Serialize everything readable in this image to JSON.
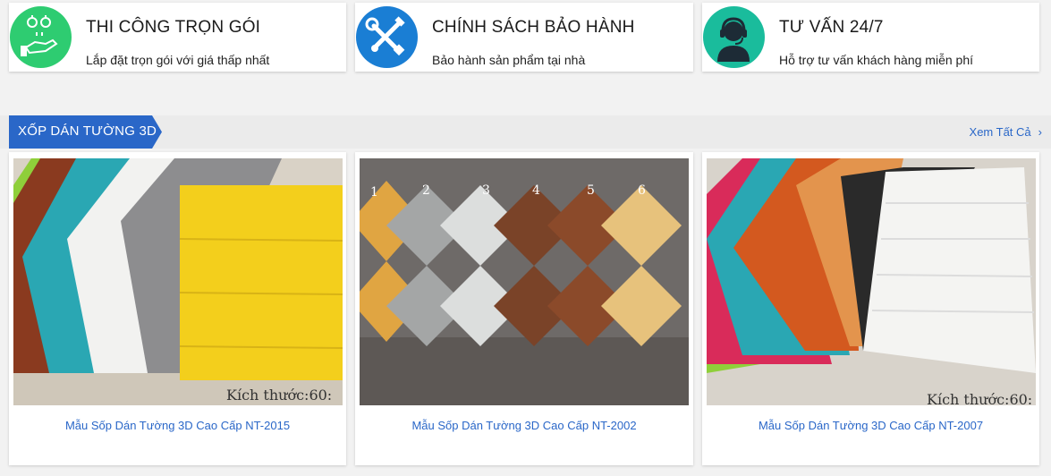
{
  "features": [
    {
      "title": "THI CÔNG TRỌN GÓI",
      "desc": "Lắp đặt trọn gói với giá thấp nhất",
      "icon": "money-hand-icon",
      "color": "#2ecc71"
    },
    {
      "title": "CHÍNH SÁCH BẢO HÀNH",
      "desc": "Bảo hành sản phẩm tại nhà",
      "icon": "tools-icon",
      "color": "#1a7ed4"
    },
    {
      "title": "TƯ VẤN 24/7",
      "desc": "Hỗ trợ tư vấn khách hàng miễn phí",
      "icon": "support-agent-icon",
      "color": "#1abc9c"
    }
  ],
  "section": {
    "title": "XỐP DÁN TƯỜNG 3D",
    "see_all": "Xem Tất Cả",
    "accent": "#2a67c8"
  },
  "products": [
    {
      "name": "Mẫu Sốp Dán Tường 3D Cao Cấp NT-2015",
      "image_text": "Kích thước:60:",
      "image": "wood-grain-panels"
    },
    {
      "name": "Mẫu Sốp Dán Tường 3D Cao Cấp NT-2002",
      "image_numbers": [
        "1",
        "2",
        "3",
        "4",
        "5",
        "6"
      ],
      "image": "diamond-tiles"
    },
    {
      "name": "Mẫu Sốp Dán Tường 3D Cao Cấp NT-2007",
      "image_text": "Kích thước:60:",
      "image": "brick-panels"
    }
  ]
}
